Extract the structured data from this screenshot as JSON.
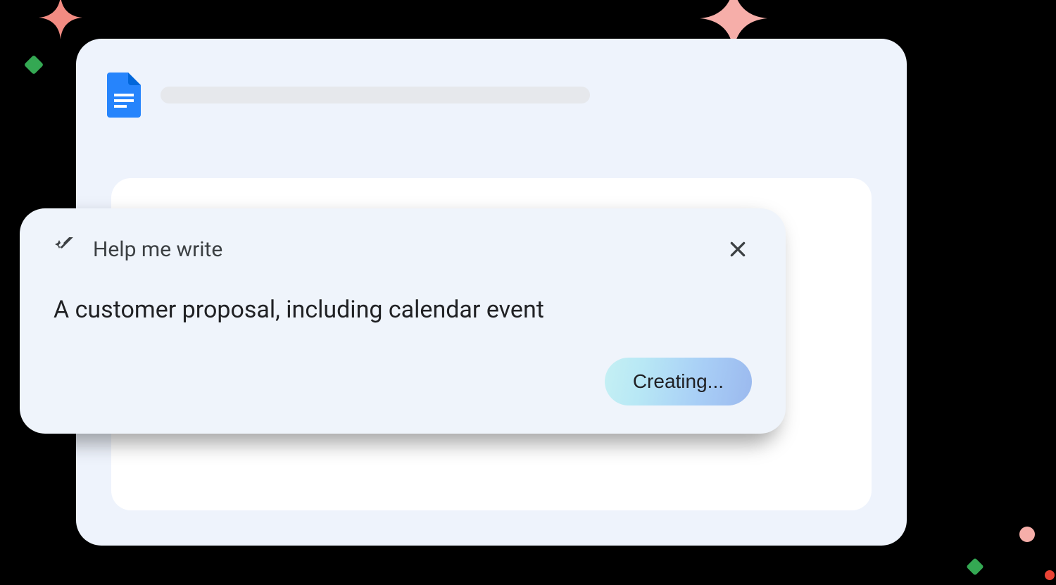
{
  "prompt_card": {
    "title": "Help me write",
    "prompt_text": "A customer proposal, including calendar event",
    "action_label": "Creating...",
    "close_aria": "Close"
  },
  "icons": {
    "docs": "docs-icon",
    "wand": "magic-wand-icon",
    "close": "close-icon"
  },
  "colors": {
    "app_bg": "#eef3fc",
    "card_bg": "#eff4fb",
    "page_bg": "#ffffff",
    "text_primary": "#202124",
    "text_secondary": "#3c4043",
    "docs_blue": "#2684fc",
    "sparkle_coral": "#f28b82",
    "sparkle_pink": "#f6aea9",
    "sparkle_yellow": "#fbbc04",
    "sparkle_green": "#34a853"
  }
}
